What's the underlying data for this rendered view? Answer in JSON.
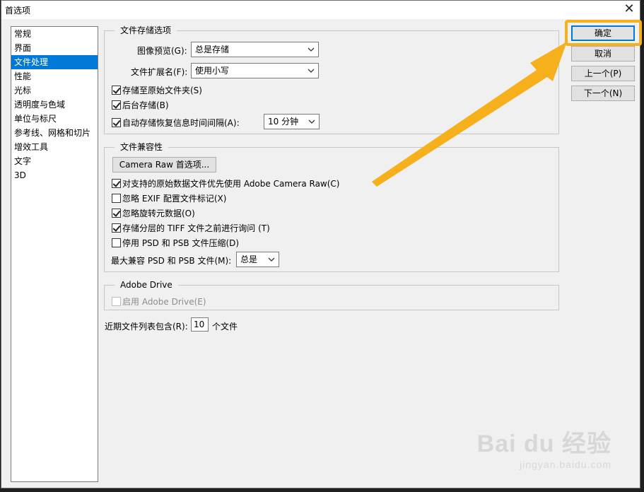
{
  "window": {
    "title": "首选项",
    "close_glyph": "✕"
  },
  "sidebar": {
    "items": [
      {
        "label": "常规"
      },
      {
        "label": "界面"
      },
      {
        "label": "文件处理"
      },
      {
        "label": "性能"
      },
      {
        "label": "光标"
      },
      {
        "label": "透明度与色域"
      },
      {
        "label": "单位与标尺"
      },
      {
        "label": "参考线、网格和切片"
      },
      {
        "label": "增效工具"
      },
      {
        "label": "文字"
      },
      {
        "label": "3D"
      }
    ],
    "selected": "文件处理"
  },
  "file_saving": {
    "legend": "文件存储选项",
    "image_preview_label": "图像预览(G):",
    "image_preview_value": "总是存储",
    "extension_label": "文件扩展名(F):",
    "extension_value": "使用小写",
    "save_original_folder": {
      "label": "存储至原始文件夹(S)",
      "checked": true
    },
    "background_save": {
      "label": "后台存储(B)",
      "checked": true
    },
    "auto_save": {
      "label": "自动存储恢复信息时间间隔(A):",
      "checked": true
    },
    "auto_save_interval": "10 分钟"
  },
  "compatibility": {
    "legend": "文件兼容性",
    "camera_raw_button": "Camera Raw 首选项...",
    "prefer_camera_raw": {
      "label": "对支持的原始数据文件优先使用 Adobe Camera Raw(C)",
      "checked": true
    },
    "ignore_exif": {
      "label": "忽略 EXIF 配置文件标记(X)",
      "checked": false
    },
    "ignore_rotation": {
      "label": "忽略旋转元数据(O)",
      "checked": true
    },
    "ask_tiff": {
      "label": "存储分层的 TIFF 文件之前进行询问 (T)",
      "checked": true
    },
    "disable_compression": {
      "label": "停用 PSD 和 PSB 文件压缩(D)",
      "checked": false
    },
    "max_compat_label": "最大兼容 PSD 和 PSB 文件(M):",
    "max_compat_value": "总是"
  },
  "adobe_drive": {
    "legend": "Adobe Drive",
    "enable": {
      "label": "启用 Adobe Drive(E)",
      "checked": false,
      "disabled": true
    }
  },
  "recent_files": {
    "label_before": "近期文件列表包含(R):",
    "value": "10",
    "label_after": "个文件"
  },
  "buttons": {
    "ok": "确定",
    "cancel": "取消",
    "prev": "上一个(P)",
    "next": "下一个(N)"
  },
  "annotation": {
    "arrow_color": "#f5b01b"
  },
  "watermark": {
    "text": "Bai du 经验",
    "url": "jingyan.baidu.com"
  },
  "colors": {
    "accent": "#0078d7",
    "highlight": "#f5b01b",
    "dialog_bg": "#f0f0f0"
  }
}
